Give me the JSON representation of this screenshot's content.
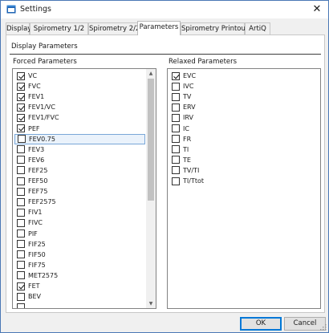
{
  "window": {
    "title": "Settings",
    "close_glyph": "✕"
  },
  "tabs": [
    {
      "label": "Display"
    },
    {
      "label": "Spirometry 1/2"
    },
    {
      "label": "Spirometry 2/2"
    },
    {
      "label": "Parameters"
    },
    {
      "label": "Spirometry Printout"
    },
    {
      "label": "ArtiQ"
    }
  ],
  "active_tab": "Parameters",
  "group": {
    "title": "Display Parameters"
  },
  "forced": {
    "label": "Forced Parameters",
    "items": [
      {
        "label": "VC",
        "checked": true
      },
      {
        "label": "FVC",
        "checked": true
      },
      {
        "label": "FEV1",
        "checked": true
      },
      {
        "label": "FEV1/VC",
        "checked": true
      },
      {
        "label": "FEV1/FVC",
        "checked": true
      },
      {
        "label": "PEF",
        "checked": true
      },
      {
        "label": "FEV0.75",
        "checked": false,
        "focused": true
      },
      {
        "label": "FEV3",
        "checked": false
      },
      {
        "label": "FEV6",
        "checked": false
      },
      {
        "label": "FEF25",
        "checked": false
      },
      {
        "label": "FEF50",
        "checked": false
      },
      {
        "label": "FEF75",
        "checked": false
      },
      {
        "label": "FEF2575",
        "checked": false
      },
      {
        "label": "FIV1",
        "checked": false
      },
      {
        "label": "FIVC",
        "checked": false
      },
      {
        "label": "PIF",
        "checked": false
      },
      {
        "label": "FIF25",
        "checked": false
      },
      {
        "label": "FIF50",
        "checked": false
      },
      {
        "label": "FIF75",
        "checked": false
      },
      {
        "label": "MET2575",
        "checked": false
      },
      {
        "label": "FET",
        "checked": true
      },
      {
        "label": "BEV",
        "checked": false
      },
      {
        "label": "",
        "checked": false
      }
    ]
  },
  "relaxed": {
    "label": "Relaxed Parameters",
    "items": [
      {
        "label": "EVC",
        "checked": true
      },
      {
        "label": "IVC",
        "checked": false
      },
      {
        "label": "TV",
        "checked": false
      },
      {
        "label": "ERV",
        "checked": false
      },
      {
        "label": "IRV",
        "checked": false
      },
      {
        "label": "IC",
        "checked": false
      },
      {
        "label": "FR",
        "checked": false
      },
      {
        "label": "TI",
        "checked": false
      },
      {
        "label": "TE",
        "checked": false
      },
      {
        "label": "TV/TI",
        "checked": false
      },
      {
        "label": "TI/Ttot",
        "checked": false
      }
    ]
  },
  "buttons": {
    "ok": "OK",
    "cancel": "Cancel"
  },
  "icons": {
    "up_arrow": "▲",
    "down_arrow": "▼",
    "app_icon": "settings-window-icon",
    "resize_grip": "resize-grip-icon"
  },
  "colors": {
    "accent": "#0078d7",
    "window_border": "#4a78b5",
    "focus": "#7aa7d8"
  }
}
